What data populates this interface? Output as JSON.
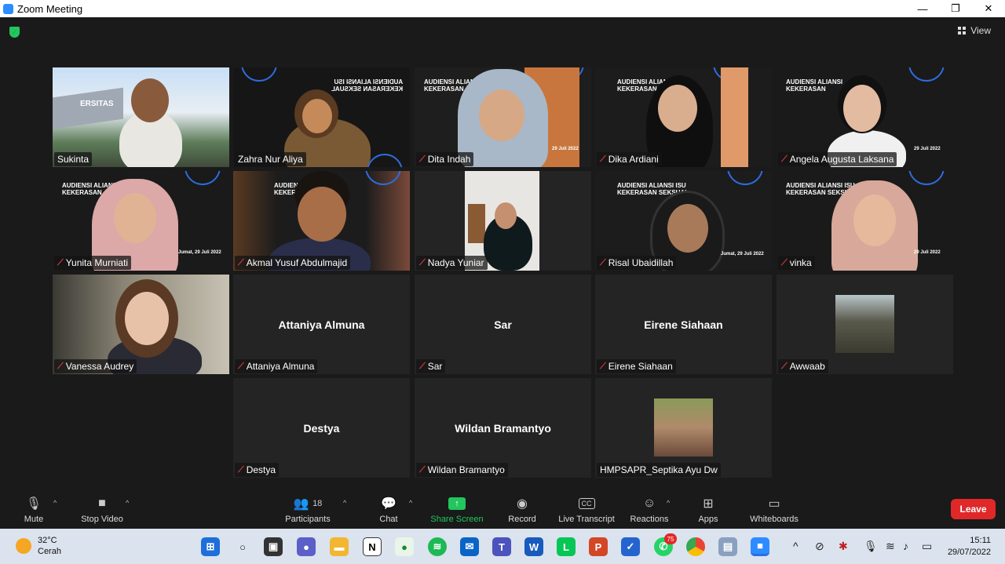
{
  "window": {
    "title": "Zoom Meeting",
    "minimize": "—",
    "restore": "❐",
    "close": "✕"
  },
  "view": {
    "label": "View"
  },
  "participants_tiles": [
    {
      "name": "Sukinta",
      "muted": false
    },
    {
      "name": "Zahra Nur Aliya",
      "muted": false
    },
    {
      "name": "Dita Indah",
      "muted": true
    },
    {
      "name": "Dika Ardiani",
      "muted": true
    },
    {
      "name": "Angela Augusta Laksana",
      "muted": true
    },
    {
      "name": "Yunita Murniati",
      "muted": true
    },
    {
      "name": "Akmal Yusuf Abdulmajid",
      "muted": true
    },
    {
      "name": "Nadya Yuniar",
      "muted": true
    },
    {
      "name": "Risal Ubaidillah",
      "muted": true
    },
    {
      "name": "vinka",
      "muted": true
    },
    {
      "name": "Vanessa Audrey",
      "muted": true
    },
    {
      "name": "Attaniya Almuna",
      "muted": true,
      "center": "Attaniya Almuna"
    },
    {
      "name": "Sar",
      "muted": true,
      "center": "Sar"
    },
    {
      "name": "Eirene Siahaan",
      "muted": true,
      "center": "Eirene Siahaan"
    },
    {
      "name": "Awwaab",
      "muted": true
    },
    {
      "name": "Destya",
      "muted": true,
      "center": "Destya"
    },
    {
      "name": "Wildan Bramantyo",
      "muted": true,
      "center": "Wildan Bramantyo"
    },
    {
      "name": "HMPSAPR_Septika Ayu Dw",
      "muted": false
    }
  ],
  "background_text": {
    "line1": "AUDIENSI ALIANSI ISU",
    "line2": "KEKERASAN SEKSUAL",
    "short1": "AUDIENSI ALIANSI",
    "short2": "KEKERASAN",
    "date": "Jumat, 29 Juli 2022",
    "date_short": "29 Juli 2022",
    "banner": "ERSITAS"
  },
  "toolbar": {
    "mute": "Mute",
    "stop_video": "Stop Video",
    "participants": "Participants",
    "participants_count": "18",
    "chat": "Chat",
    "share_screen": "Share Screen",
    "record": "Record",
    "live_transcript": "Live Transcript",
    "reactions": "Reactions",
    "apps": "Apps",
    "whiteboards": "Whiteboards",
    "leave": "Leave"
  },
  "taskbar": {
    "temperature": "32°C",
    "condition": "Cerah",
    "time": "15:11",
    "date": "29/07/2022",
    "whatsapp_badge": "75"
  },
  "colors": {
    "accent": "#2d8cff",
    "active_border": "#c8e65a",
    "leave": "#e02828",
    "share": "#22c55e"
  }
}
